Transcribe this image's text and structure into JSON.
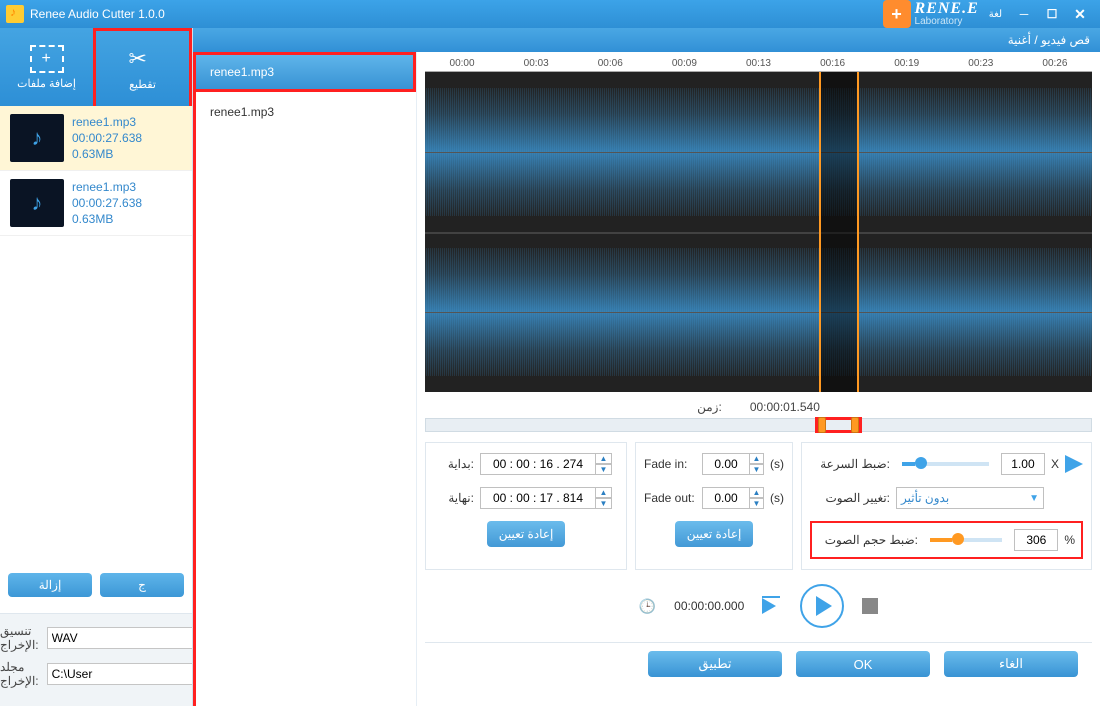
{
  "window": {
    "title": "Renee Audio Cutter 1.0.0"
  },
  "logo": {
    "brand": "RENE.E",
    "sub": "Laboratory",
    "lang": "لغة"
  },
  "toolbar": {
    "add_label": "إضافة ملفات",
    "cut_label": "تقطيع"
  },
  "files": [
    {
      "name": "renee1.mp3",
      "duration": "00:00:27.638",
      "size": "0.63MB"
    },
    {
      "name": "renee1.mp3",
      "duration": "00:00:27.638",
      "size": "0.63MB"
    }
  ],
  "left_buttons": {
    "remove": "إزالة",
    "other": "ج"
  },
  "output": {
    "format_label": "تنسيق الإخراج:",
    "format_value": "WAV",
    "folder_label": "مجلد الإخراج:",
    "folder_value": "C:\\User"
  },
  "editor_header": "قص فيديو / أغنية",
  "editor_sidebar": [
    "renee1.mp3",
    "renee1.mp3"
  ],
  "ruler": [
    "00:00",
    "00:03",
    "00:06",
    "00:09",
    "00:13",
    "00:16",
    "00:19",
    "00:23",
    "00:26"
  ],
  "time": {
    "label": "زمن:",
    "value": "00:00:01.540"
  },
  "range": {
    "start_label": "بداية:",
    "start_value": "00 : 00 : 16 . 274",
    "end_label": "نهاية:",
    "end_value": "00 : 00 : 17 . 814",
    "reset": "إعادة تعيين"
  },
  "fade": {
    "in_label": "Fade in:",
    "in_value": "0.00",
    "out_label": "Fade out:",
    "out_value": "0.00",
    "unit": "(s)",
    "reset": "إعادة تعيين"
  },
  "right": {
    "speed_label": "ضبط السرعة:",
    "speed_value": "1.00",
    "speed_unit": "X",
    "sound_label": "تغيير الصوت:",
    "sound_value": "بدون تأثير",
    "volume_label": "ضبط حجم الصوت:",
    "volume_value": "306",
    "volume_unit": "%"
  },
  "transport": {
    "time": "00:00:00.000"
  },
  "footer": {
    "apply": "تطبيق",
    "ok": "OK",
    "cancel": "الغاء"
  }
}
